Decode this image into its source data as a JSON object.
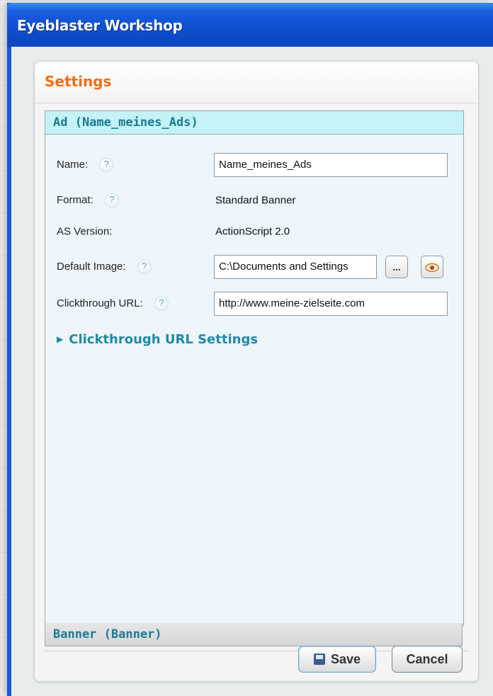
{
  "window": {
    "title": "Eyeblaster Workshop"
  },
  "panel": {
    "title": "Settings"
  },
  "section_ad": {
    "title": "Ad (Name_meines_Ads)"
  },
  "fields": {
    "name": {
      "label": "Name:",
      "value": "Name_meines_Ads"
    },
    "format": {
      "label": "Format:",
      "value": "Standard Banner"
    },
    "as_version": {
      "label": "AS Version:",
      "value": "ActionScript 2.0"
    },
    "default_image": {
      "label": "Default Image:",
      "value": "C:\\Documents and Settings"
    },
    "clickthrough_url": {
      "label": "Clickthrough URL:",
      "value": "http://www.meine-zielseite.com"
    }
  },
  "help_glyph": "?",
  "browse_label": "...",
  "expander": {
    "label": "Clickthrough URL Settings"
  },
  "section_banner": {
    "title": "Banner (Banner)"
  },
  "buttons": {
    "save": "Save",
    "cancel": "Cancel"
  },
  "colors": {
    "title_bar": "#0f4fd0",
    "panel_title": "#ef6f15",
    "section_header_bg": "#c4f2f6",
    "link": "#1f8aa8"
  },
  "icons": [
    "help-icon",
    "eye-icon",
    "save-disk-icon",
    "expand-arrow-icon"
  ]
}
